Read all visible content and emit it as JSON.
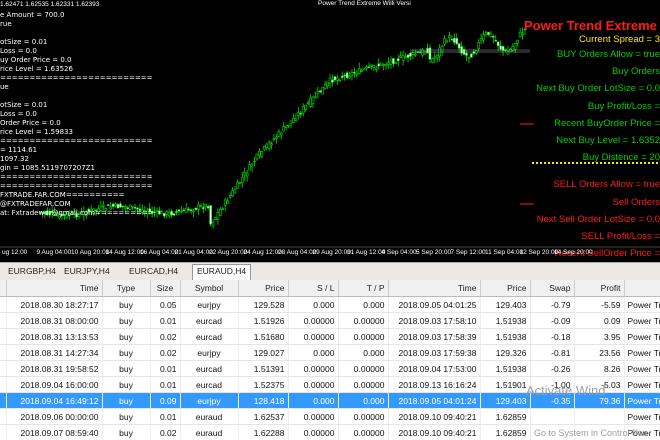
{
  "chart": {
    "header_line": "1.62471 1.62535 1.62331 1.62393",
    "window_title": "Power Trend Extreme Willi Versi",
    "left_overlay": [
      "e Amount = 700.0",
      "rue",
      "",
      "otSize = 0.01",
      "Loss = 0.0",
      "uy Order Price = 0.0",
      "rice Level = 1.63526",
      "==========================",
      "ue",
      "",
      "otSize = 0.01",
      "Loss = 0.0",
      "Order Price = 0.0",
      "rice Level = 1.59833",
      "==========================",
      "= 1114.61",
      "1097.32",
      "gin = 1085.5119707207Z1",
      "==========================",
      "==========================",
      "FXTRADE.FAR.COM==========",
      "@FXTRADEFAR.COM",
      "at: Fxtradewar@gmail.com=========="
    ],
    "x_axis_labels": [
      "ug 12:00",
      "9 Aug 04:00",
      "10 Aug 20:00",
      "14 Aug 12:00",
      "16 Aug 04:00",
      "21 Aug 04:00",
      "22 Aug 20:00",
      "24 Aug 12:00",
      "28 Aug 04:00",
      "29 Aug 20:00",
      "31 Aug 12:00",
      "4 Sep 04:00",
      "5 Sep 20:00",
      "7 Sep 12:00",
      "11 Sep 04:00",
      "12 Sep 20:00",
      "14 Sep 20:00"
    ],
    "panel": {
      "title": "Power Trend Extreme",
      "rows": [
        {
          "text": "Current Spread = 3",
          "color": "#ffe800"
        },
        {
          "text": "BUY Orders Allow = true",
          "color": "#00d000"
        },
        {
          "text": "Buy Orders",
          "color": "#00d000"
        },
        {
          "text": "Next Buy Order LotSize = 0.0",
          "color": "#00d000"
        },
        {
          "text": "Buy Profit/Loss =",
          "color": "#00d000"
        },
        {
          "text": "Recent BuyOrder Price =",
          "color": "#00d000"
        },
        {
          "text": "Next Buy Level = 1.6352",
          "color": "#00d000"
        },
        {
          "text": "Buy Distence = 20",
          "color": "#00d000"
        },
        {
          "text": "SELL Orders Allow = true",
          "color": "#ff1a1a"
        },
        {
          "text": "Sell Orders",
          "color": "#ff1a1a"
        },
        {
          "text": "Next Sell Order LotSize = 0.0",
          "color": "#ff1a1a"
        },
        {
          "text": "SELL Profit/Loss =",
          "color": "#ff1a1a"
        },
        {
          "text": "Recent SellOrder Price =",
          "color": "#ff1a1a"
        }
      ]
    }
  },
  "tabs": [
    "EURGBP,H4",
    "EURJPY,H4",
    "EURCAD,H4",
    "EURAUD,H4"
  ],
  "active_tab": "EURAUD,H4",
  "table": {
    "columns": [
      "",
      "Time",
      "Type",
      "Size",
      "Symbol",
      "Price",
      "S / L",
      "T / P",
      "Time",
      "Price",
      "Swap",
      "Profit",
      ""
    ],
    "rows": [
      [
        "",
        "2018.08.30 18:27:17",
        "buy",
        "0.05",
        "eurjpy",
        "129.528",
        "0.000",
        "0.000",
        "2018.09.05 04:01:25",
        "129.403",
        "-0.79",
        "-5.59",
        "Power Trend E"
      ],
      [
        "",
        "2018.08.31 08:00:00",
        "buy",
        "0.01",
        "eurcad",
        "1.51926",
        "0.00000",
        "0.00000",
        "2018.09.03 17:58:10",
        "1.51938",
        "-0.09",
        "0.09",
        "Power Trend E"
      ],
      [
        "",
        "2018.08.31 13:13:53",
        "buy",
        "0.02",
        "eurcad",
        "1.51680",
        "0.00000",
        "0.00000",
        "2018.09.03 17:58:39",
        "1.51938",
        "-0.18",
        "3.95",
        "Power Trend E"
      ],
      [
        "",
        "2018.08.31 14:27:34",
        "buy",
        "0.02",
        "eurjpy",
        "129.027",
        "0.000",
        "0.000",
        "2018.09.03 17:59:38",
        "129.326",
        "-0.81",
        "23.56",
        "Power Trend E"
      ],
      [
        "",
        "2018.08.31 19:58:52",
        "buy",
        "0.01",
        "eurcad",
        "1.51391",
        "0.00000",
        "0.00000",
        "2018.09.04 17:53:00",
        "1.51938",
        "-0.26",
        "8.26",
        "Power Trend E"
      ],
      [
        "",
        "2018.09.04 16:00:00",
        "buy",
        "0.01",
        "eurcad",
        "1.52375",
        "0.00000",
        "0.00000",
        "2018.09.13 16:16:24",
        "1.51901",
        "-1.00",
        "-5.03",
        "Power Trend E"
      ],
      [
        "",
        "2018.09.04 16:49:12",
        "buy",
        "0.09",
        "eurjpy",
        "128.418",
        "0.000",
        "0.000",
        "2018.09.05 04:01:24",
        "129.403",
        "-0.35",
        "79.36",
        "Power Trend E"
      ],
      [
        "",
        "2018.09.06 00:00:00",
        "buy",
        "0.01",
        "euraud",
        "1.62537",
        "0.00000",
        "0.00000",
        "2018.09.10 09:40:21",
        "1.62859",
        "",
        "",
        "Power Trend E"
      ],
      [
        "",
        "2018.09.07 08:59:40",
        "buy",
        "0.02",
        "euraud",
        "1.62288",
        "0.00000",
        "0.00000",
        "2018.09.10 09:40:21",
        "1.62859",
        "",
        "",
        "Power Trend E"
      ]
    ],
    "selected_row": 6
  },
  "watermark": {
    "line1": "Activate Wind",
    "line2": "Go to System in Control Pan"
  }
}
